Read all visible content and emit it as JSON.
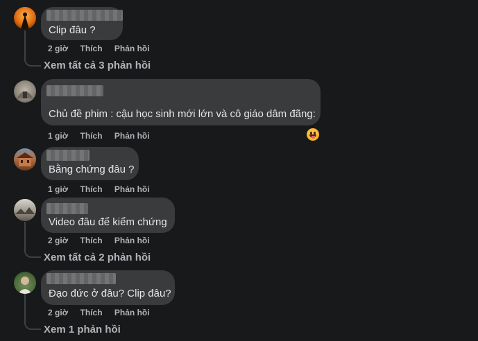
{
  "comments": [
    {
      "text": "Clip đâu ?",
      "time": "2 giờ",
      "like": "Thích",
      "reply": "Phản hồi",
      "view_replies": "Xem tất cả 3 phản hồi"
    },
    {
      "text": "Chủ đề phim : cậu học sinh mới lớn và cô giáo dâm đãng:",
      "time": "1 giờ",
      "like": "Thích",
      "reply": "Phản hồi"
    },
    {
      "text": "Bằng chứng đâu ?",
      "time": "1 giờ",
      "like": "Thích",
      "reply": "Phản hồi"
    },
    {
      "text": "Video đâu để kiểm chứng",
      "time": "2 giờ",
      "like": "Thích",
      "reply": "Phản hồi",
      "view_replies": "Xem tất cả 2 phản hồi"
    },
    {
      "text": "Đạo đức ở đâu? Clip đâu?",
      "time": "2 giờ",
      "like": "Thích",
      "reply": "Phản hồi",
      "view_replies": "Xem 1 phản hồi"
    }
  ],
  "colors": {
    "background": "#18191a",
    "bubble": "#3a3b3c",
    "text": "#e4e6eb",
    "secondary_text": "#b0b3b8"
  }
}
